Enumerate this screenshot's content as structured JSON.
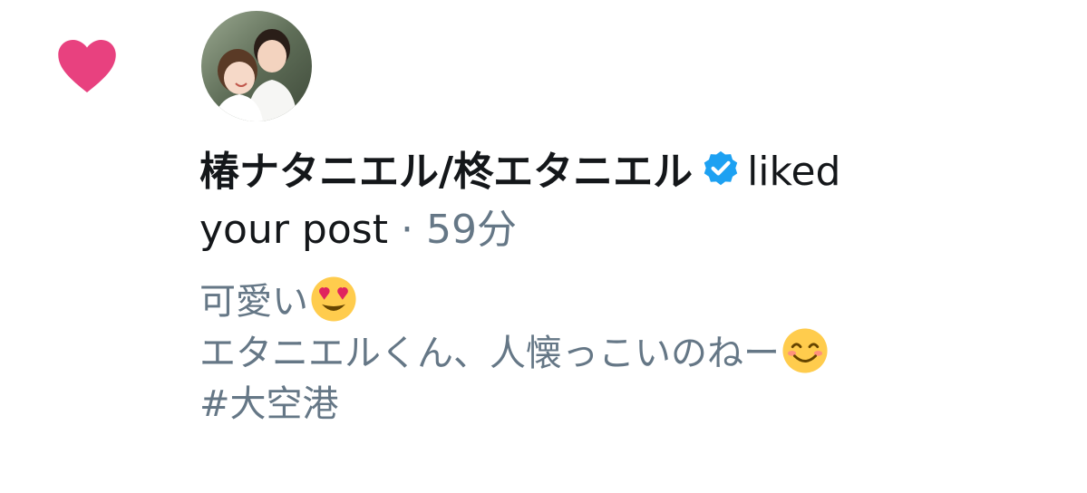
{
  "notification": {
    "icon": "heart-icon",
    "icon_color": "#e0245e",
    "user_name": "椿ナタニエル/柊エタニエル",
    "verified": true,
    "verified_color": "#1da1f2",
    "action_part1": "liked",
    "action_part2": "your post",
    "separator": "·",
    "time": "59分"
  },
  "tweet": {
    "line1": "可愛い",
    "line2": "エタニエルくん、人懐っこいのねー",
    "hashtag": "#大空港",
    "emoji1": "heart-eyes-emoji",
    "emoji2": "smiling-face-emoji"
  },
  "colors": {
    "primary_text": "#14171a",
    "secondary_text": "#657786"
  }
}
